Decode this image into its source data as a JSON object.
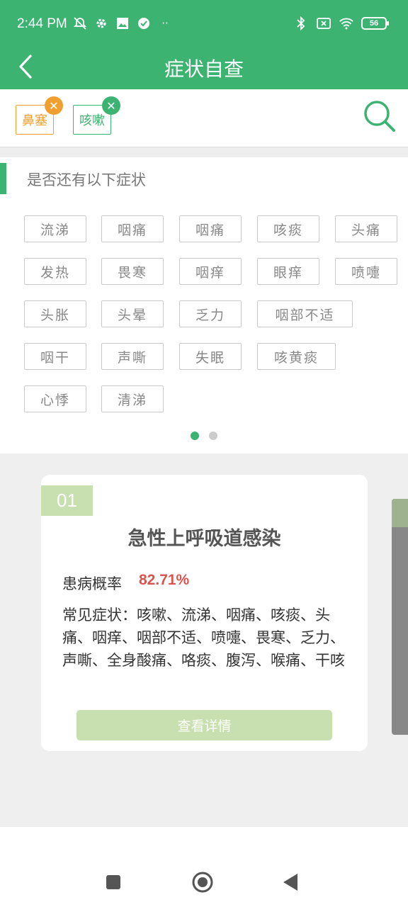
{
  "status": {
    "time": "2:44 PM",
    "battery": "56"
  },
  "header": {
    "title": "症状自查"
  },
  "selected_chips": [
    {
      "label": "鼻塞",
      "color": "#f0a030"
    },
    {
      "label": "咳嗽",
      "color": "#3cb371"
    }
  ],
  "section": {
    "title": "是否还有以下症状"
  },
  "symptoms": [
    "流涕",
    "咽痛",
    "咽痛",
    "咳痰",
    "头痛",
    "发热",
    "畏寒",
    "咽痒",
    "眼痒",
    "喷嚏",
    "头胀",
    "头晕",
    "乏力",
    "咽部不适",
    "咽干",
    "声嘶",
    "失眠",
    "咳黄痰",
    "心悸",
    "清涕"
  ],
  "pager": {
    "count": 2,
    "active": 0
  },
  "card": {
    "number": "01",
    "title": "急性上呼吸道感染",
    "prob_label": "患病概率",
    "prob_value": "82.71%",
    "symptoms_text": "常见症状：咳嗽、流涕、咽痛、咳痰、头痛、咽痒、咽部不适、喷嚏、畏寒、乏力、声嘶、全身酸痛、咯痰、腹泻、喉痛、干咳",
    "detail_button": "查看详情"
  },
  "colors": {
    "primary": "#3cb371",
    "chip_orange": "#f0a030",
    "probability": "#d9534f",
    "card_accent": "#c8dfb0"
  }
}
